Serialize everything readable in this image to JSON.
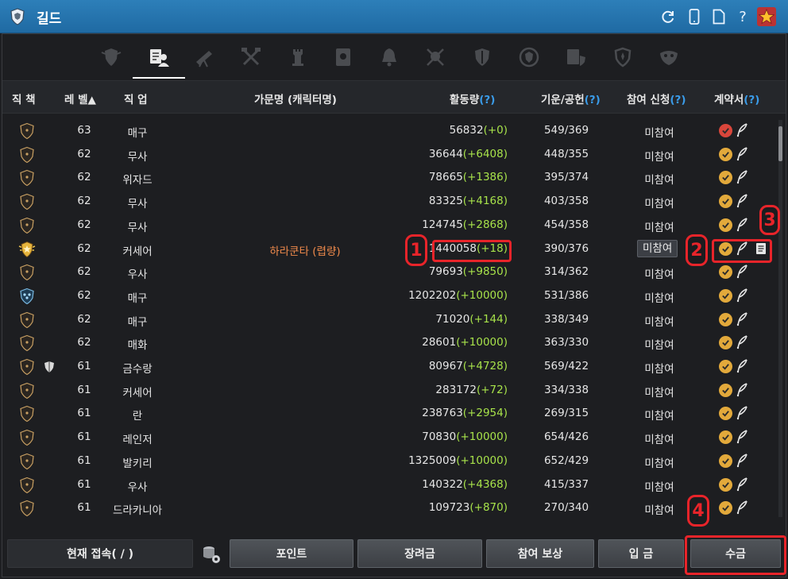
{
  "window": {
    "title": "길드"
  },
  "titlebar_icons": [
    "refresh-icon",
    "mobile-icon",
    "document-icon",
    "help-icon",
    "star-icon"
  ],
  "tabs": [
    {
      "name": "guild-emblem",
      "active": false
    },
    {
      "name": "member-list",
      "active": true
    },
    {
      "name": "telescope",
      "active": false
    },
    {
      "name": "crossed-tools",
      "active": false
    },
    {
      "name": "tower",
      "active": false
    },
    {
      "name": "scroll-board",
      "active": false
    },
    {
      "name": "bell",
      "active": false
    },
    {
      "name": "skull-crossed",
      "active": false
    },
    {
      "name": "shield",
      "active": false
    },
    {
      "name": "laurel-emblem",
      "active": false
    },
    {
      "name": "document-shield",
      "active": false
    },
    {
      "name": "fleur-shield",
      "active": false
    },
    {
      "name": "mask",
      "active": false
    }
  ],
  "columns": {
    "rank": "직 책",
    "level": "레 벨▲",
    "class": "직 업",
    "family_name": "가문명 (캐릭터명)",
    "activity": "활동량",
    "activity_help": "(?)",
    "energy": "기운/공헌",
    "energy_help": "(?)",
    "participation": "참여 신청",
    "participation_help": "(?)",
    "contract": "계약서",
    "contract_help": "(?)"
  },
  "members": [
    {
      "rank_icon": "member",
      "level": "63",
      "class": "매구",
      "name": "",
      "activity": "56832",
      "delta": "(+0)",
      "energy": "549/369",
      "participation": "미참여",
      "check": "red",
      "extra_shield": false,
      "doc": false
    },
    {
      "rank_icon": "member",
      "level": "62",
      "class": "무사",
      "name": "",
      "activity": "36644",
      "delta": "(+6408)",
      "energy": "448/355",
      "participation": "미참여",
      "check": "gold",
      "extra_shield": false,
      "doc": false
    },
    {
      "rank_icon": "member",
      "level": "62",
      "class": "위자드",
      "name": "",
      "activity": "78665",
      "delta": "(+1386)",
      "energy": "395/374",
      "participation": "미참여",
      "check": "gold",
      "extra_shield": false,
      "doc": false
    },
    {
      "rank_icon": "member",
      "level": "62",
      "class": "무사",
      "name": "",
      "activity": "83325",
      "delta": "(+4168)",
      "energy": "403/358",
      "participation": "미참여",
      "check": "gold",
      "extra_shield": false,
      "doc": false
    },
    {
      "rank_icon": "member",
      "level": "62",
      "class": "무사",
      "name": "",
      "activity": "124745",
      "delta": "(+2868)",
      "energy": "454/358",
      "participation": "미참여",
      "check": "gold",
      "extra_shield": false,
      "doc": false
    },
    {
      "rank_icon": "master",
      "level": "62",
      "class": "커세어",
      "name": "하라쿤타 (렵량)",
      "activity": "1440058",
      "delta": "(+18)",
      "energy": "390/376",
      "participation": "미참여",
      "check": "gold",
      "extra_shield": false,
      "doc": true,
      "button": true
    },
    {
      "rank_icon": "member",
      "level": "62",
      "class": "우사",
      "name": "",
      "activity": "79693",
      "delta": "(+9850)",
      "energy": "314/362",
      "participation": "미참여",
      "check": "gold",
      "extra_shield": false,
      "doc": false
    },
    {
      "rank_icon": "officer",
      "level": "62",
      "class": "매구",
      "name": "",
      "activity": "1202202",
      "delta": "(+10000)",
      "energy": "531/386",
      "participation": "미참여",
      "check": "gold",
      "extra_shield": false,
      "doc": false
    },
    {
      "rank_icon": "member",
      "level": "62",
      "class": "매구",
      "name": "",
      "activity": "71020",
      "delta": "(+144)",
      "energy": "338/349",
      "participation": "미참여",
      "check": "gold",
      "extra_shield": false,
      "doc": false
    },
    {
      "rank_icon": "member",
      "level": "62",
      "class": "매화",
      "name": "",
      "activity": "28601",
      "delta": "(+10000)",
      "energy": "363/330",
      "participation": "미참여",
      "check": "gold",
      "extra_shield": false,
      "doc": false
    },
    {
      "rank_icon": "member",
      "level": "61",
      "class": "금수랑",
      "name": "",
      "activity": "80967",
      "delta": "(+4728)",
      "energy": "569/422",
      "participation": "미참여",
      "check": "gold",
      "extra_shield": true,
      "doc": false
    },
    {
      "rank_icon": "member",
      "level": "61",
      "class": "커세어",
      "name": "",
      "activity": "283172",
      "delta": "(+72)",
      "energy": "334/338",
      "participation": "미참여",
      "check": "gold",
      "extra_shield": false,
      "doc": false
    },
    {
      "rank_icon": "member",
      "level": "61",
      "class": "란",
      "name": "",
      "activity": "238763",
      "delta": "(+2954)",
      "energy": "269/315",
      "participation": "미참여",
      "check": "gold",
      "extra_shield": false,
      "doc": false
    },
    {
      "rank_icon": "member",
      "level": "61",
      "class": "레인저",
      "name": "",
      "activity": "70830",
      "delta": "(+10000)",
      "energy": "654/426",
      "participation": "미참여",
      "check": "gold",
      "extra_shield": false,
      "doc": false
    },
    {
      "rank_icon": "member",
      "level": "61",
      "class": "발키리",
      "name": "",
      "activity": "1325009",
      "delta": "(+10000)",
      "energy": "652/429",
      "participation": "미참여",
      "check": "gold",
      "extra_shield": false,
      "doc": false
    },
    {
      "rank_icon": "member",
      "level": "61",
      "class": "우사",
      "name": "",
      "activity": "140322",
      "delta": "(+4368)",
      "energy": "415/337",
      "participation": "미참여",
      "check": "gold",
      "extra_shield": false,
      "doc": false
    },
    {
      "rank_icon": "member",
      "level": "61",
      "class": "드라카니아",
      "name": "",
      "activity": "109723",
      "delta": "(+870)",
      "energy": "270/340",
      "participation": "미참여",
      "check": "gold",
      "extra_shield": false,
      "doc": false
    }
  ],
  "annotations": [
    "1",
    "2",
    "3",
    "4"
  ],
  "footer": {
    "connected": "현재 접속(   /   )",
    "points": "포인트",
    "bonus": "장려금",
    "participation_reward": "참여 보상",
    "deposit": "입 금",
    "collect": "수금"
  },
  "colors": {
    "plus": "#a7e24a",
    "guild_name": "#f08a4b",
    "help": "#3a9be8",
    "annotation": "#e8242a",
    "titlebar": "#2277b0"
  }
}
